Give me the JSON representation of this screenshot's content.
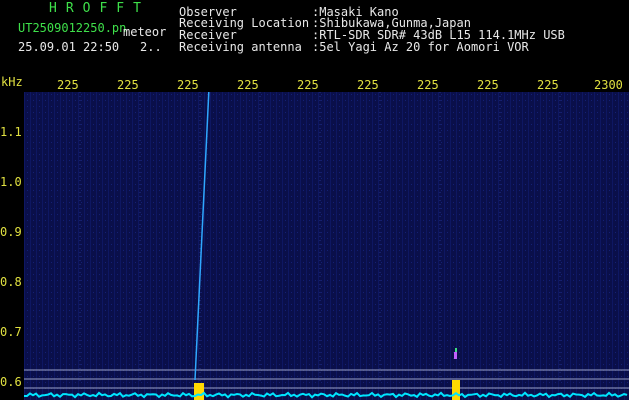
{
  "header": {
    "brand": "HROFFT",
    "filename": "UT2509012250.pn",
    "label": "meteor",
    "datetime": "25.09.01 22:50",
    "extra": "2..",
    "fields": [
      {
        "name": "Observer",
        "value": ":Masaki Kano"
      },
      {
        "name": "Receiving Location",
        "value": ":Shibukawa,Gunma,Japan"
      },
      {
        "name": "Receiver",
        "value": ":RTL-SDR SDR# 43dB L15 114.1MHz USB"
      },
      {
        "name": "Receiving antenna",
        "value": ":5el Yagi Az 20 for Aomori VOR"
      }
    ]
  },
  "axes": {
    "y_unit": "kHz",
    "x_ticks": [
      "225",
      "225",
      "225",
      "225",
      "225",
      "225",
      "225",
      "225",
      "225",
      "225",
      "2300"
    ],
    "y_ticks": [
      "1.1",
      "1.0",
      "0.9",
      "0.8",
      "0.7",
      "0.6"
    ]
  },
  "colors": {
    "background": "#000000",
    "plot_bg": "#0a0f4a",
    "text_green": "#3ee04a",
    "text_white": "#e8e8e8",
    "tick_yellow": "#e0e040",
    "echo": "#2fa8ff",
    "noise_floor": "#00e5ff",
    "burst": "#ffd800"
  }
}
